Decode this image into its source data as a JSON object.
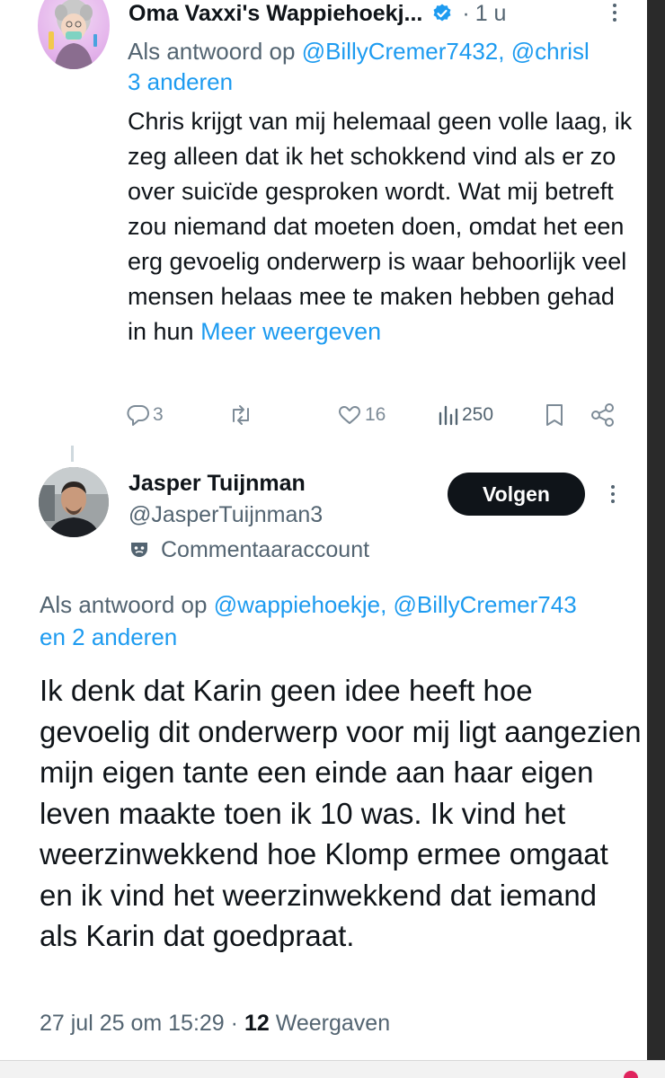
{
  "tweet1": {
    "display_name": "Oma Vaxxi's Wappiehoekj...",
    "separator": "·",
    "time": "1 u",
    "reply_prefix": "Als antwoord op",
    "reply_mentions": "@BillyCremer7432, @chrisl",
    "reply_others": "3 anderen",
    "text": "Chris krijgt van mij helemaal geen volle laag, ik zeg alleen dat ik het schokkend vind als er zo over suicïde gesproken wordt. Wat mij betreft zou niemand dat moeten doen, omdat het een erg gevoelig onderwerp is waar behoorlijk veel mensen helaas mee te maken hebben gehad in hun",
    "more_link": "Meer weergeven",
    "stats": {
      "replies": "3",
      "likes": "16",
      "views": "250"
    }
  },
  "tweet2": {
    "display_name": "Jasper Tuijnman",
    "handle": "@JasperTuijnman3",
    "account_label": "Commentaaraccount",
    "follow_label": "Volgen",
    "reply_prefix": "Als antwoord op",
    "reply_mentions": "@wappiehoekje, @BillyCremer743",
    "reply_others": "en 2 anderen",
    "text": "Ik denk dat Karin geen idee heeft hoe gevoelig dit onderwerp voor mij ligt aangezien mijn eigen tante een einde aan haar eigen leven maakte toen ik 10 was. Ik vind het weerzinwekkend hoe Klomp ermee omgaat en ik vind het weerzinwekkend dat iemand als Karin dat goedpraat.",
    "date": "27 jul 25 om 15:29",
    "meta_separator": "·",
    "views_count": "12",
    "views_label": "Weergaven"
  },
  "colors": {
    "link": "#1d9bf0",
    "secondary_text": "#536471",
    "primary_text": "#0f1419",
    "follow_bg": "#0f1419"
  }
}
